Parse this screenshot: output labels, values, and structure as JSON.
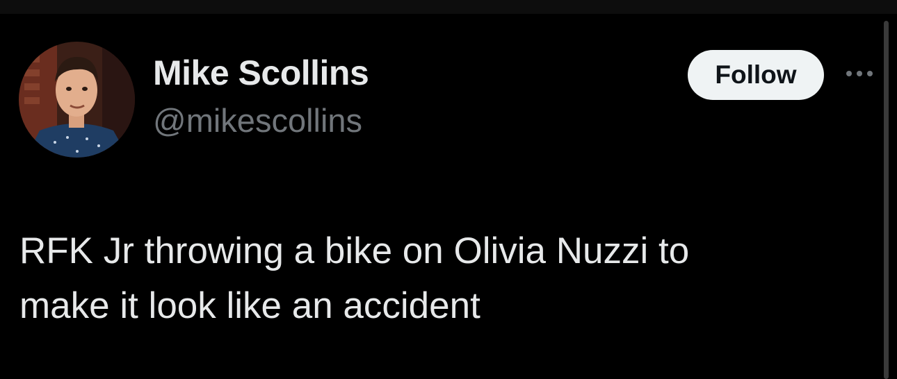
{
  "author": {
    "display_name": "Mike Scollins",
    "handle": "@mikescollins",
    "avatar_icon": "profile-photo"
  },
  "actions": {
    "follow_label": "Follow",
    "more_icon": "more-horizontal-icon"
  },
  "tweet": {
    "text_lines": [
      "RFK Jr throwing a bike on Olivia Nuzzi to",
      "make it look like an accident"
    ]
  },
  "colors": {
    "background": "#000000",
    "primary_text": "#e7e9ea",
    "secondary_text": "#71767b",
    "follow_bg": "#eff3f4",
    "follow_text": "#0f1419"
  }
}
